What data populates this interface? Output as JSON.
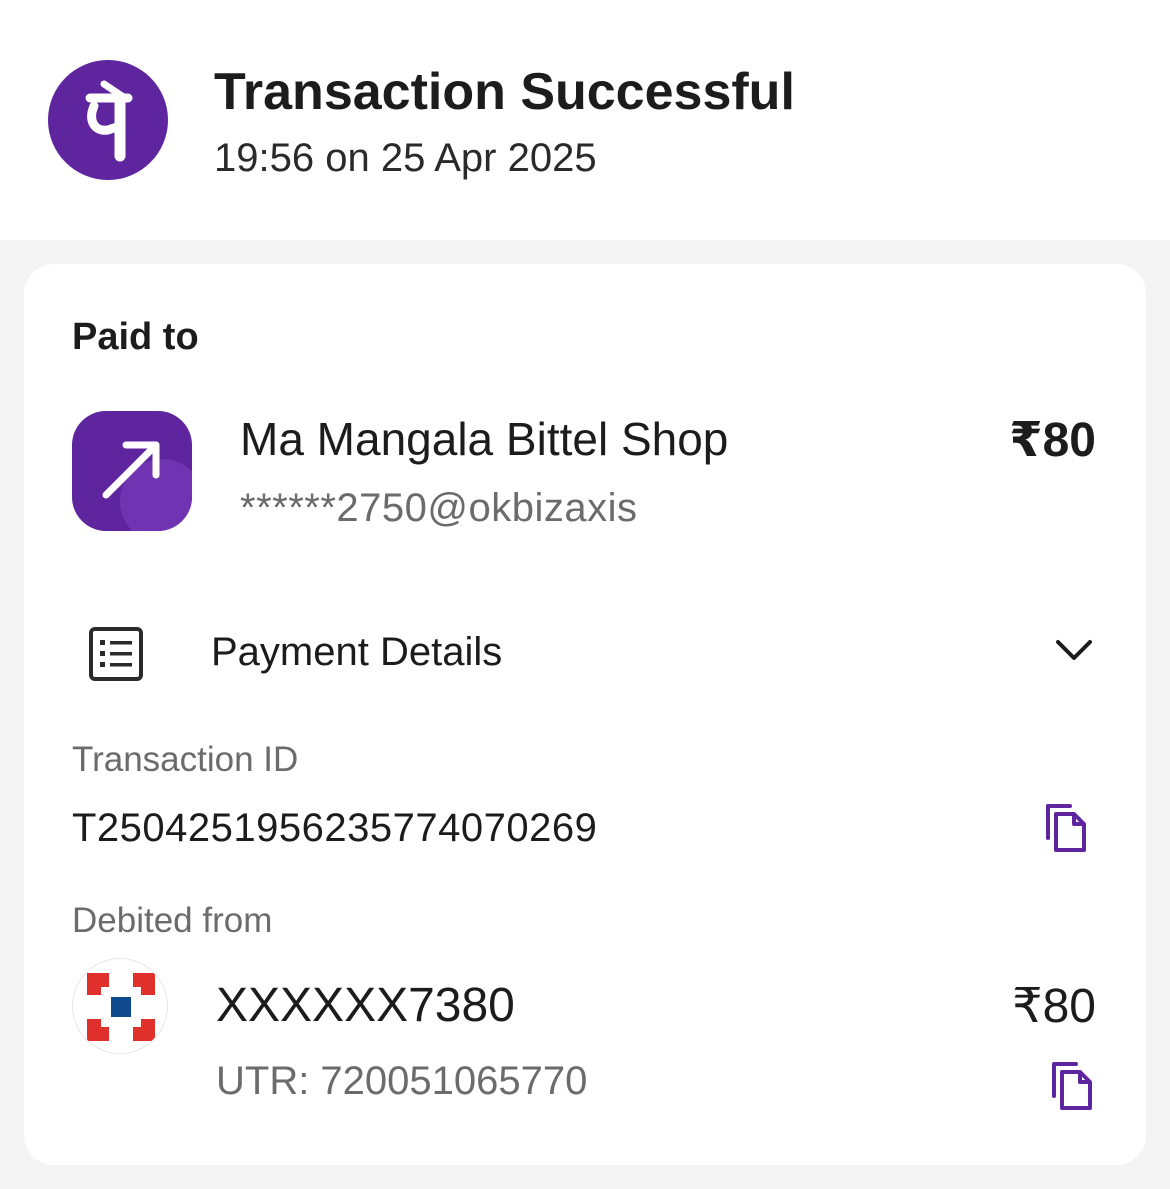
{
  "header": {
    "logo_glyph": "पे",
    "title": "Transaction Successful",
    "timestamp": "19:56 on 25 Apr 2025",
    "brand_color": "#5f259f"
  },
  "paid_to": {
    "label": "Paid to",
    "payee_icon": "arrow-up-right-icon",
    "name": "Ma Mangala Bittel Shop",
    "upi_id": "******2750@okbizaxis",
    "amount": "₹80"
  },
  "payment_details": {
    "label": "Payment Details",
    "icon": "receipt-list-icon",
    "toggle_icon": "chevron-down-icon",
    "transaction_id_label": "Transaction ID",
    "transaction_id": "T2504251956235774070269",
    "copy_icon": "copy-icon",
    "debited_from_label": "Debited from",
    "bank_icon": "hdfc-bank-logo",
    "account": "XXXXXX7380",
    "utr": "UTR: 720051065770",
    "debit_amount": "₹80"
  },
  "colors": {
    "accent": "#5f259f",
    "bank_red": "#e0302b",
    "bank_blue": "#0f4a8f"
  }
}
